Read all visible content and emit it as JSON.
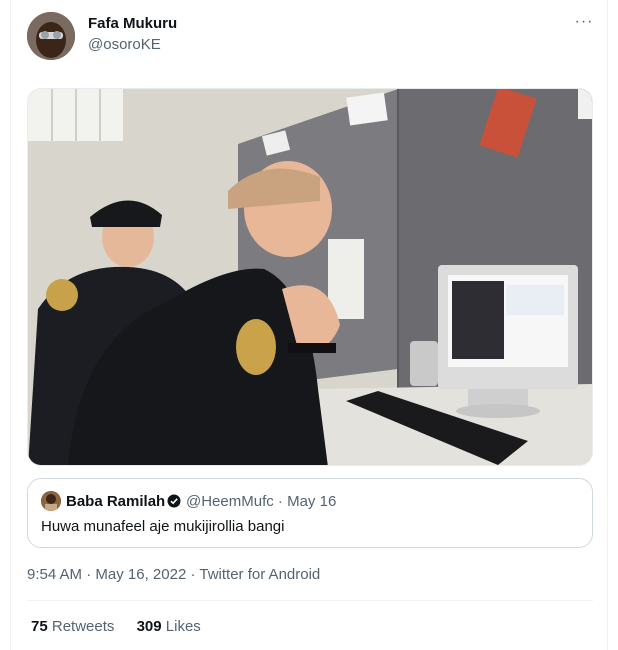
{
  "tweet": {
    "author_name": "Fafa Mukuru",
    "author_handle": "@osoroKE",
    "more_icon": "more-horizontal-icon",
    "photo_alt": "",
    "quoted": {
      "author_name": "Baba Ramilah",
      "verified_icon": "verified-badge-icon",
      "author_handle": "@HeemMufc",
      "separator": "·",
      "date": "May 16",
      "text": "Huwa munafeel aje mukijirollia bangi"
    },
    "time": "9:54 AM",
    "date": "May 16, 2022",
    "source": "Twitter for Android",
    "sep": "·",
    "retweets_count": "75",
    "retweets_label": "Retweets",
    "likes_count": "309",
    "likes_label": "Likes"
  }
}
